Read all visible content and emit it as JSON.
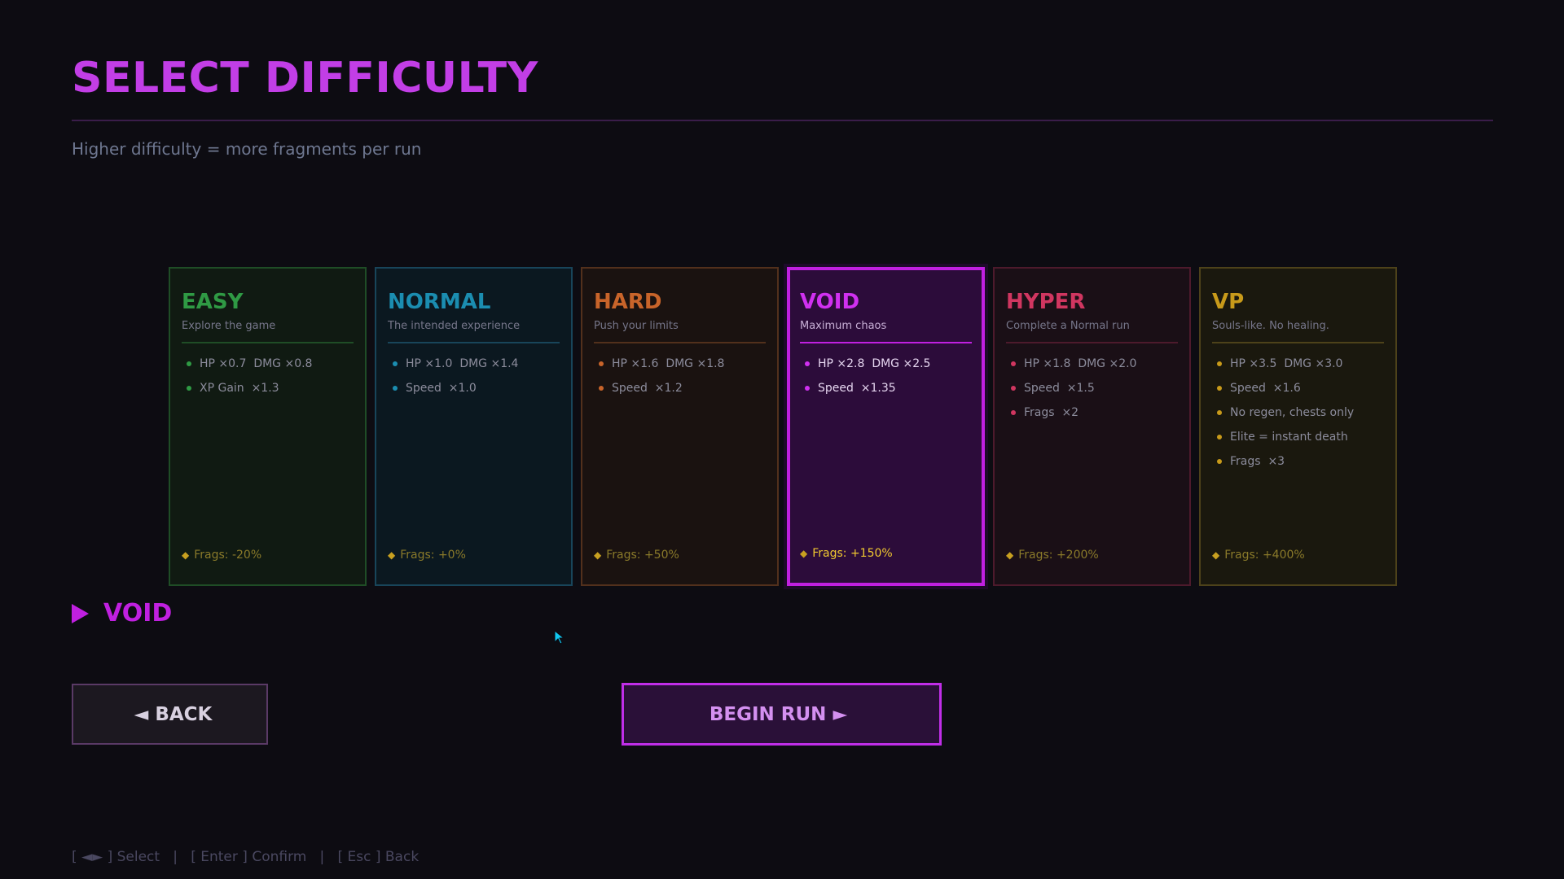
{
  "colors": {
    "background": "#0d0c12",
    "title": "#c23ee6",
    "subtitle": "#6e7790",
    "accent": "#c020e0",
    "hint": "#4a4860"
  },
  "header": {
    "title": "SELECT DIFFICULTY",
    "subtitle": "Higher difficulty = more fragments per run"
  },
  "difficulties": [
    {
      "name": "EASY",
      "tagline": "Explore the game",
      "stats": [
        "HP ×0.7  DMG ×0.8",
        "XP Gain  ×1.3"
      ],
      "frags": "Frags: -20%",
      "color": "#2f9a44",
      "bg": "#101a12",
      "border": "#1f4d26",
      "selected": false
    },
    {
      "name": "NORMAL",
      "tagline": "The intended experience",
      "stats": [
        "HP ×1.0  DMG ×1.4",
        "Speed  ×1.0"
      ],
      "frags": "Frags: +0%",
      "color": "#1b8db0",
      "bg": "#0b1820",
      "border": "#18455a",
      "selected": false
    },
    {
      "name": "HARD",
      "tagline": "Push your limits",
      "stats": [
        "HP ×1.6  DMG ×1.8",
        "Speed  ×1.2"
      ],
      "frags": "Frags: +50%",
      "color": "#c8642a",
      "bg": "#1a1210",
      "border": "#52301c",
      "selected": false
    },
    {
      "name": "VOID",
      "tagline": "Maximum chaos",
      "stats": [
        "HP ×2.8  DMG ×2.5",
        "Speed  ×1.35"
      ],
      "frags": "Frags: +150%",
      "color": "#d030f0",
      "bg": "#2c0c3a",
      "border": "#c020e0",
      "selected": true
    },
    {
      "name": "HYPER",
      "tagline": "Complete a Normal run",
      "stats": [
        "HP ×1.8  DMG ×2.0",
        "Speed  ×1.5",
        "Frags  ×2"
      ],
      "frags": "Frags: +200%",
      "color": "#d03660",
      "bg": "#1a0f16",
      "border": "#4d1a2c",
      "selected": false
    },
    {
      "name": "VP",
      "tagline": "Souls-like. No healing.",
      "stats": [
        "HP ×3.5  DMG ×3.0",
        "Speed  ×1.6",
        "No regen, chests only",
        "Elite = instant death",
        "Frags  ×3"
      ],
      "frags": "Frags: +400%",
      "color": "#c89a1a",
      "bg": "#1a180e",
      "border": "#4d421a",
      "selected": false
    }
  ],
  "selection": {
    "current": "VOID"
  },
  "buttons": {
    "back_arrow": "◄",
    "back_label": "BACK",
    "begin_label": "BEGIN RUN",
    "begin_arrow": "►"
  },
  "footer": {
    "hint": "[ ◄► ] Select   |   [ Enter ] Confirm   |   [ Esc ] Back"
  }
}
